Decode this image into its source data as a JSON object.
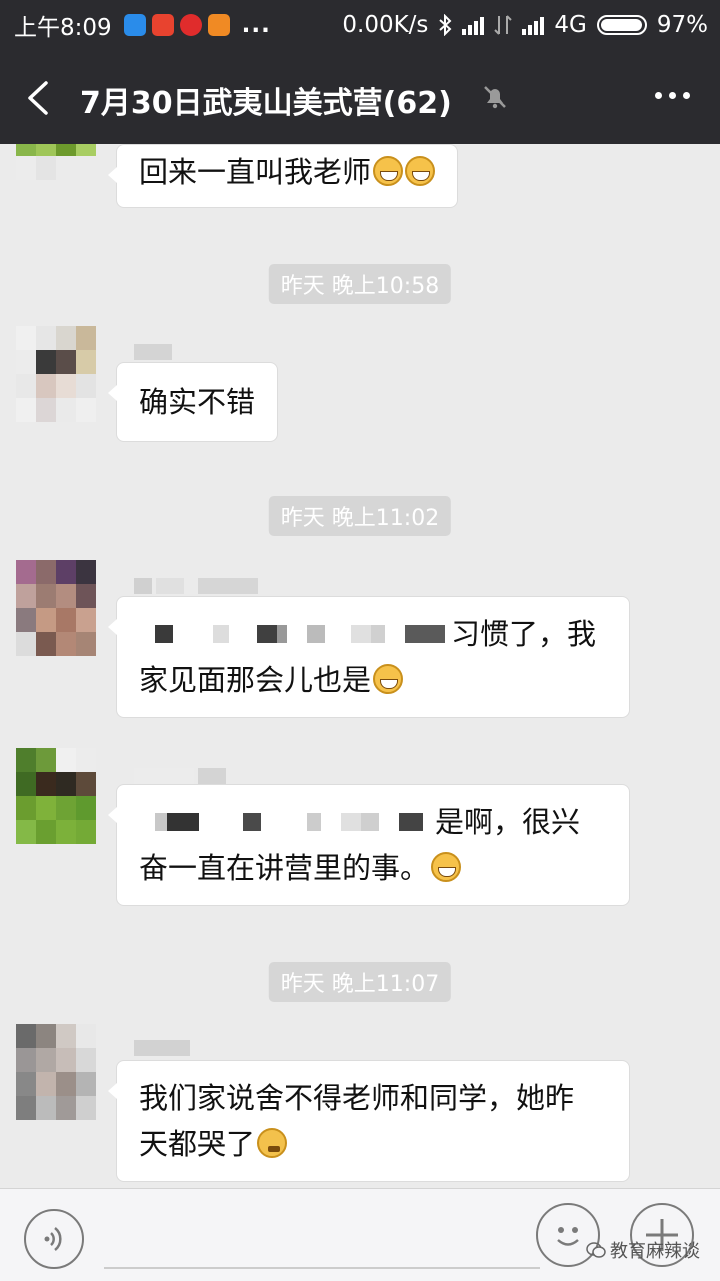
{
  "status_bar": {
    "time": "上午8:09",
    "more_indicator": "...",
    "net_speed": "0.00K/s",
    "network": "4G",
    "battery": "97%",
    "battery_level": 0.97
  },
  "header": {
    "title": "7月30日武夷山美式营(62)",
    "icons": [
      "back-icon",
      "mute-icon",
      "more-icon"
    ]
  },
  "chat": {
    "messages": [
      {
        "text": "回来一直叫我老师",
        "emoji": "grinning-emoji"
      },
      {
        "timestamp": "昨天 晚上10:58"
      },
      {
        "text": "确实不错"
      },
      {
        "timestamp": "昨天 晚上11:02"
      },
      {
        "text_line1_visible": "习惯了，我",
        "text_line2": "家见面那会儿也是",
        "emoji": "grinning-emoji"
      },
      {
        "text_line1_visible": "是啊，很兴",
        "text_line2": "奋一直在讲营里的事。",
        "emoji": "grinning-emoji"
      },
      {
        "timestamp": "昨天 晚上11:07"
      },
      {
        "text_line1": "我们家说舍不得老师和同学，她昨",
        "text_line2": "天都哭了",
        "emoji": "thinking-emoji"
      }
    ]
  },
  "watermark": "教育麻辣谈",
  "colors": {
    "status_bar_bg": "#2b2b2f",
    "chat_bg": "#ebebeb",
    "bubble_bg": "#ffffff",
    "timestamp_bg": "#d6d6d6"
  }
}
